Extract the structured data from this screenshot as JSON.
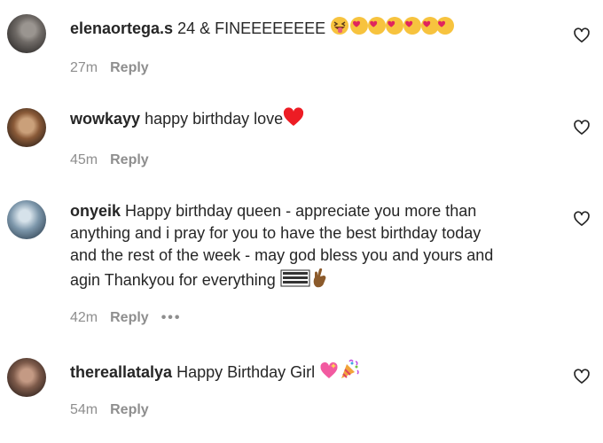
{
  "comments": [
    {
      "username": "elenaortega.s",
      "text": "24 & FINEEEEEEEE",
      "time": "27m",
      "reply": "Reply"
    },
    {
      "username": "wowkayy",
      "text": "happy birthday love",
      "time": "45m",
      "reply": "Reply"
    },
    {
      "username": "onyeik",
      "lines": [
        "Happy birthday queen - appreciate you more than",
        "anything and i pray for you to have the best birthday today",
        "and the rest of the week - may god bless you and yours and",
        "agin Thankyou for everything"
      ],
      "time": "42m",
      "reply": "Reply",
      "more": "•••"
    },
    {
      "username": "thereallatalya",
      "text": "Happy Birthday Girl",
      "time": "54m",
      "reply": "Reply"
    }
  ],
  "icons": {
    "like": "heart-outline-icon"
  },
  "colors": {
    "text": "#262626",
    "meta": "#8e8e8e",
    "heart_emoji": "#ed1c24"
  }
}
